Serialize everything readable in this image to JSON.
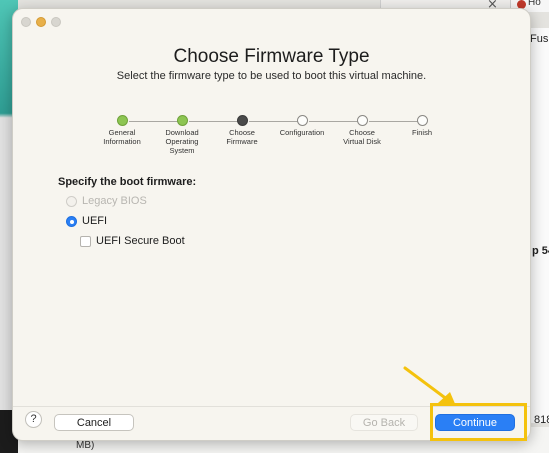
{
  "background": {
    "tab_text": "Ho",
    "tab_close": "×",
    "right_fragments": [
      "Fus",
      "p 54",
      "818"
    ],
    "bottom_text": "MB)"
  },
  "dialog": {
    "title": "Choose Firmware Type",
    "subtitle": "Select the firmware type to be used to boot this virtual machine.",
    "steps": [
      {
        "label": "General Information",
        "state": "done"
      },
      {
        "label": "Download Operating System",
        "state": "done"
      },
      {
        "label": "Choose Firmware",
        "state": "current"
      },
      {
        "label": "Configuration",
        "state": "pending"
      },
      {
        "label": "Choose Virtual Disk",
        "state": "pending"
      },
      {
        "label": "Finish",
        "state": "pending"
      }
    ],
    "section_label": "Specify the boot firmware:",
    "options": {
      "legacy_bios": {
        "label": "Legacy BIOS",
        "selected": false,
        "enabled": false
      },
      "uefi": {
        "label": "UEFI",
        "selected": true,
        "enabled": true
      },
      "secure_boot": {
        "label": "UEFI Secure Boot",
        "checked": false
      }
    },
    "footer": {
      "help": "?",
      "cancel": "Cancel",
      "go_back": "Go Back",
      "continue": "Continue"
    }
  },
  "colors": {
    "accent": "#2a7ff5",
    "step_done": "#8dc552",
    "step_current": "#4a4a4a",
    "annotation": "#f4c20d"
  }
}
